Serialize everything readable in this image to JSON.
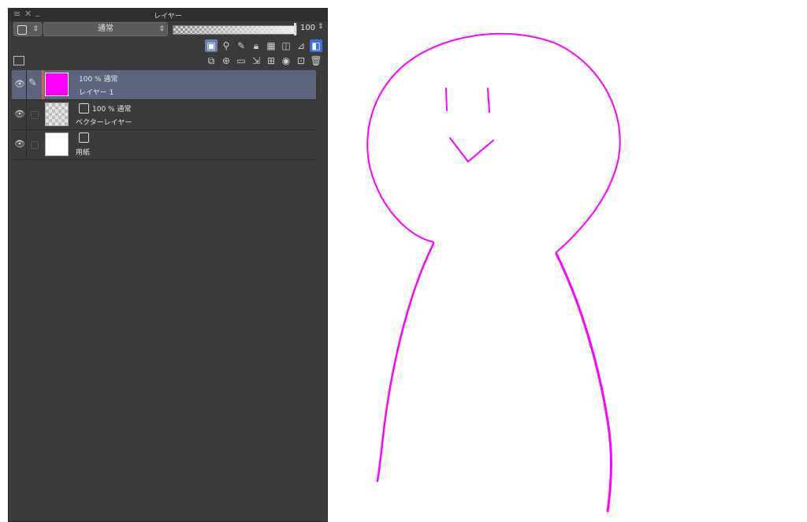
{
  "panel": {
    "title": "レイヤー",
    "blend_mode": "通常",
    "opacity_value": "100",
    "window_controls": [
      "≡",
      "✕",
      "_"
    ]
  },
  "layers": [
    {
      "opacity_mode": "100 % 通常",
      "name": "レイヤー 1",
      "thumb": "magenta",
      "selected": true
    },
    {
      "opacity_mode": "100 % 通常",
      "name": "ベクターレイヤー",
      "thumb": "transparent",
      "selected": false
    },
    {
      "opacity_mode": "",
      "name": "用紙",
      "thumb": "white",
      "selected": false
    }
  ],
  "icons": {
    "row2": [
      "clip-icon",
      "reference-icon",
      "draft-icon",
      "lock-icon",
      "lock-transparent-icon",
      "mask-icon",
      "ruler-icon",
      "palette-color-icon"
    ],
    "row3": [
      "new-raster-icon",
      "new-vector-icon",
      "new-folder-icon",
      "transfer-icon",
      "merge-icon",
      "mask-add-icon",
      "apply-mask-icon",
      "delete-icon"
    ]
  },
  "colors": {
    "stroke": "#ff00ff",
    "selection": "#5b6580",
    "panel": "#3b3b3b"
  }
}
